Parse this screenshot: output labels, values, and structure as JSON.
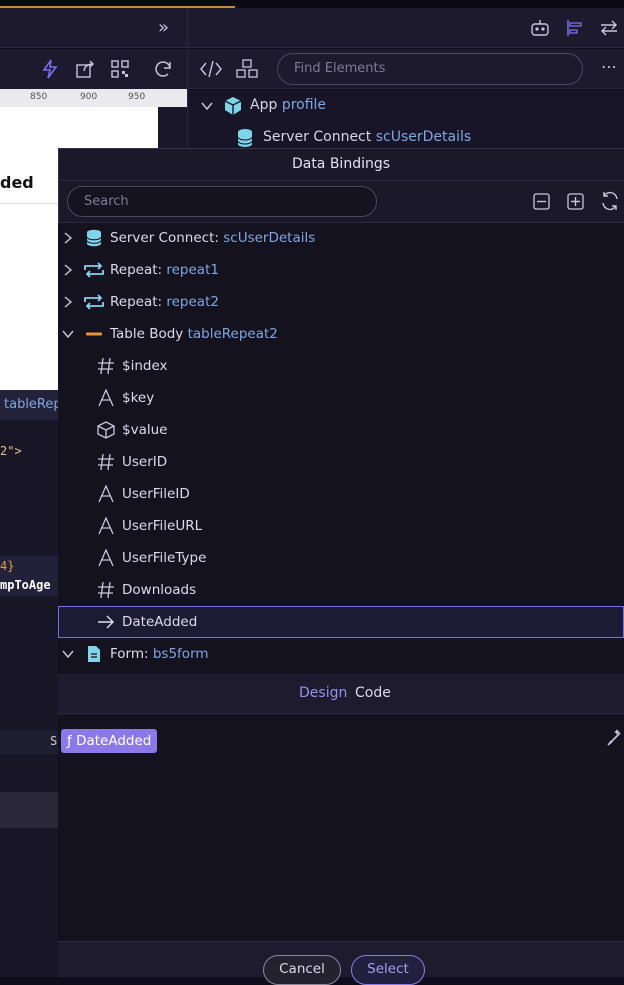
{
  "background": {
    "canvas_heading": "ded",
    "ruler_ticks": [
      "850",
      "900",
      "950"
    ],
    "code_lines": [
      "2\">",
      "4}",
      "mpToAge"
    ],
    "tag_label": "tableRep",
    "status_letter": "S"
  },
  "right_panel": {
    "find_placeholder": "Find Elements",
    "tree": [
      {
        "label": "App",
        "value": "profile"
      },
      {
        "label": "Server Connect",
        "value": "scUserDetails"
      }
    ]
  },
  "dialog": {
    "title": "Data Bindings",
    "search_placeholder": "Search",
    "rows": [
      {
        "label": "Server Connect:",
        "value": "scUserDetails",
        "icon": "database-icon"
      },
      {
        "label": "Repeat:",
        "value": "repeat1",
        "icon": "repeat-icon"
      },
      {
        "label": "Repeat:",
        "value": "repeat2",
        "icon": "repeat-icon"
      },
      {
        "label": "Table Body",
        "value": "tableRepeat2",
        "icon": "table-body-icon"
      },
      {
        "label": "$index",
        "value": "",
        "icon": "number-icon"
      },
      {
        "label": "$key",
        "value": "",
        "icon": "text-icon"
      },
      {
        "label": "$value",
        "value": "",
        "icon": "object-icon"
      },
      {
        "label": "UserID",
        "value": "",
        "icon": "number-icon"
      },
      {
        "label": "UserFileID",
        "value": "",
        "icon": "text-icon"
      },
      {
        "label": "UserFileURL",
        "value": "",
        "icon": "text-icon"
      },
      {
        "label": "UserFileType",
        "value": "",
        "icon": "text-icon"
      },
      {
        "label": "Downloads",
        "value": "",
        "icon": "number-icon"
      },
      {
        "label": "DateAdded",
        "value": "",
        "icon": "arrow-right-icon"
      },
      {
        "label": "Form:",
        "value": "bs5form",
        "icon": "form-icon"
      }
    ],
    "tabs": {
      "design": "Design",
      "code": "Code"
    },
    "expression_chip": "DateAdded",
    "chip_prefix": "ƒ",
    "cancel_label": "Cancel",
    "select_label": "Select"
  },
  "colors": {
    "accent": "#8b79e8",
    "value_text": "#7fa6e0",
    "selection_border": "#7b6cf0"
  }
}
